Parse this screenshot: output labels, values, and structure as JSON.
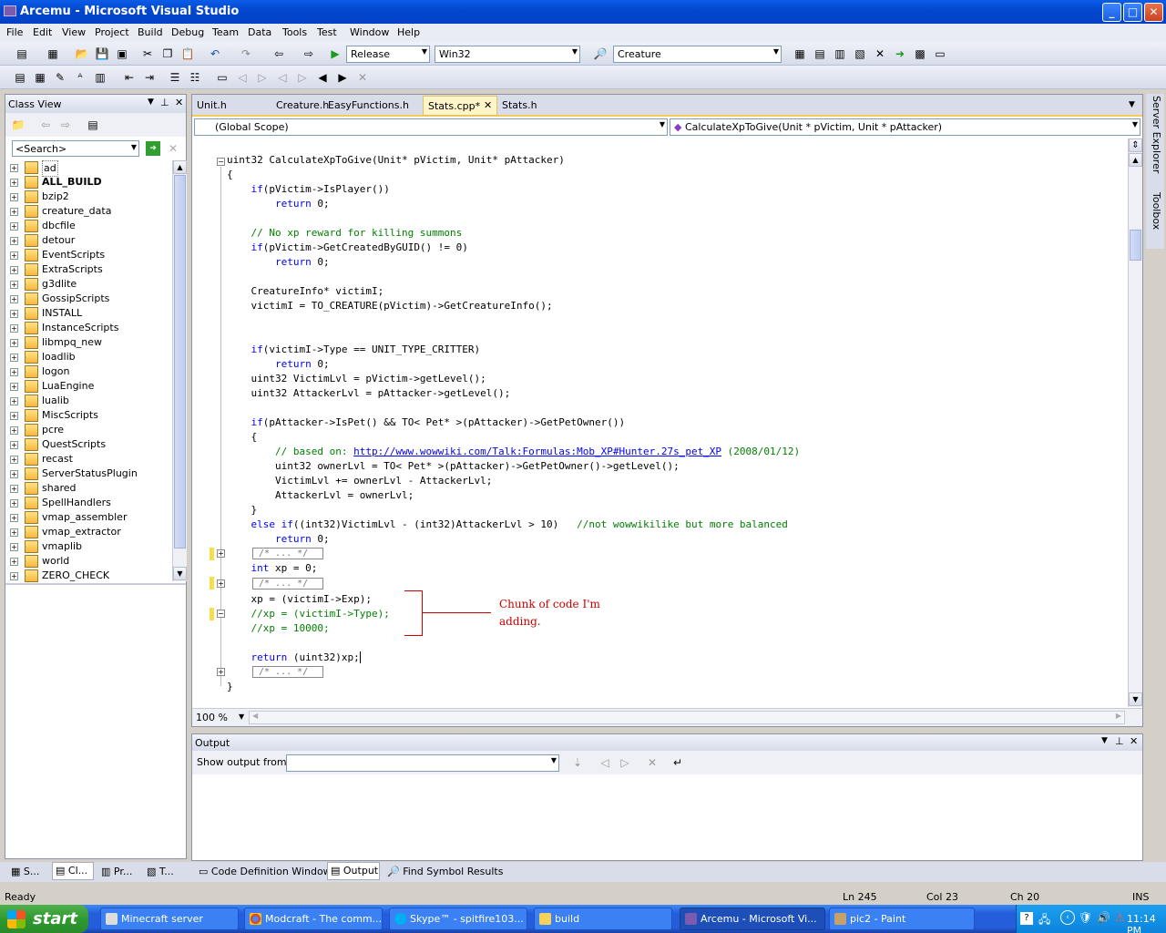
{
  "window": {
    "title": "Arcemu - Microsoft Visual Studio"
  },
  "menu": [
    "File",
    "Edit",
    "View",
    "Project",
    "Build",
    "Debug",
    "Team",
    "Data",
    "Tools",
    "Test",
    "Window",
    "Help"
  ],
  "toolbar": {
    "config": "Release",
    "platform": "Win32",
    "find": "Creature"
  },
  "classview": {
    "title": "Class View",
    "search_placeholder": "<Search>",
    "items": [
      "ad",
      "ALL_BUILD",
      "bzip2",
      "creature_data",
      "dbcfile",
      "detour",
      "EventScripts",
      "ExtraScripts",
      "g3dlite",
      "GossipScripts",
      "INSTALL",
      "InstanceScripts",
      "libmpq_new",
      "loadlib",
      "logon",
      "LuaEngine",
      "lualib",
      "MiscScripts",
      "pcre",
      "QuestScripts",
      "recast",
      "ServerStatusPlugin",
      "shared",
      "SpellHandlers",
      "vmap_assembler",
      "vmap_extractor",
      "vmaplib",
      "world",
      "ZERO_CHECK"
    ]
  },
  "tabs": [
    "Unit.h",
    "Creature.h",
    "EasyFunctions.h",
    "Stats.cpp*",
    "Stats.h"
  ],
  "scope": {
    "left": "(Global Scope)",
    "right": "CalculateXpToGive(Unit * pVictim, Unit * pAttacker)"
  },
  "code": {
    "l1a": "uint32 CalculateXpToGive(Unit* pVictim, Unit* pAttacker)",
    "l2": "{",
    "l3k": "    if",
    "l3b": "(pVictim->IsPlayer())",
    "l4k": "        return",
    "l4b": " 0;",
    "l6": "    // No xp reward for killing summons",
    "l7k": "    if",
    "l7b": "(pVictim->GetCreatedByGUID() != 0)",
    "l8k": "        return",
    "l8b": " 0;",
    "l10": "    CreatureInfo* victimI;",
    "l11": "    victimI = TO_CREATURE(pVictim)->GetCreatureInfo();",
    "l14k": "    if",
    "l14b": "(victimI->Type == UNIT_TYPE_CRITTER)",
    "l15k": "        return",
    "l15b": " 0;",
    "l16": "    uint32 VictimLvl = pVictim->getLevel();",
    "l17": "    uint32 AttackerLvl = pAttacker->getLevel();",
    "l19k": "    if",
    "l19b": "(pAttacker->IsPet() && TO< Pet* >(pAttacker)->GetPetOwner())",
    "l20": "    {",
    "l21a": "        // based on: ",
    "l21link": "http://www.wowwiki.com/Talk:Formulas:Mob_XP#Hunter.27s_pet_XP",
    "l21c": " (2008/01/12)",
    "l22": "        uint32 ownerLvl = TO< Pet* >(pAttacker)->GetPetOwner()->getLevel();",
    "l23": "        VictimLvl += ownerLvl - AttackerLvl;",
    "l24": "        AttackerLvl = ownerLvl;",
    "l25": "    }",
    "l26k": "    else if",
    "l26b": "((int32)VictimLvl - (int32)AttackerLvl > 10)   ",
    "l26c": "//not wowwikilike but more balanced",
    "l27k": "        return",
    "l27b": " 0;",
    "collapsed": "/* ... */",
    "l29k": "    int",
    "l29b": " xp = 0;",
    "l31": "    xp = (victimI->Exp);",
    "l32": "    //xp = (victimI->Type);",
    "l33": "    //xp = 10000;",
    "l35k": "    return",
    "l35b": " (uint32)xp;",
    "l37": "}"
  },
  "annotation": {
    "line1": "Chunk of code I'm",
    "line2": "adding."
  },
  "zoom": "100 %",
  "output": {
    "title": "Output",
    "show_from": "Show output from:"
  },
  "bottom_tabs": [
    "S...",
    "Cl...",
    "Pr...",
    "T...",
    "Code Definition Window",
    "Output",
    "Find Symbol Results"
  ],
  "status": {
    "ready": "Ready",
    "ln": "Ln 245",
    "col": "Col 23",
    "ch": "Ch 20",
    "ins": "INS"
  },
  "side_tabs": {
    "server": "Server Explorer",
    "toolbox": "Toolbox"
  },
  "taskbar": {
    "start": "start",
    "tasks": [
      "Minecraft server",
      "Modcraft - The comm...",
      "Skype™ - spitfire103...",
      "build",
      "Arcemu - Microsoft Vi...",
      "pic2 - Paint"
    ],
    "time": "11:14 PM"
  }
}
